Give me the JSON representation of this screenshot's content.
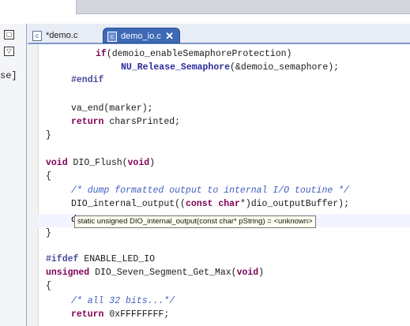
{
  "tabs": [
    {
      "label": "*demo.c",
      "icon": "c-file-icon"
    },
    {
      "label": "demo_io.c",
      "icon": "c-file-icon",
      "active": true
    }
  ],
  "left_panel": {
    "partial_text": "se]"
  },
  "code": {
    "l1_prefix": "if",
    "l1_rest": "(demoio_enableSemaphoreProtection)",
    "l2_fn": "NU_Release_Semaphore",
    "l2_rest": "(&demoio_semaphore);",
    "l3": "#endif",
    "l4": "va_end(marker);",
    "l5_kw": "return",
    "l5_rest": " charsPrinted;",
    "l6": "}",
    "l7_kw": "void",
    "l7_rest": " DIO_Flush(",
    "l7_kw2": "void",
    "l7_end": ")",
    "l8": "{",
    "l9": "/* dump formatted output to internal I/O toutine */",
    "l10_a": "DIO_internal_output((",
    "l10_kw": "const char",
    "l10_b": "*)dio_outputBuffer);",
    "l11_char": "d",
    "l12": "}",
    "l13_pp": "#ifdef",
    "l13_rest": " ENABLE_LED_IO",
    "l14_kw": "unsigned",
    "l14_rest": " DIO_Seven_Segment_Get_Max(",
    "l14_kw2": "void",
    "l14_end": ")",
    "l15": "{",
    "l16": "/* all 32 bits...*/",
    "l17_kw": "return",
    "l17_rest": " 0xFFFFFFFF;"
  },
  "hover_tooltip": "static unsigned DIO_internal_output(const char* pString) = <unknown>"
}
